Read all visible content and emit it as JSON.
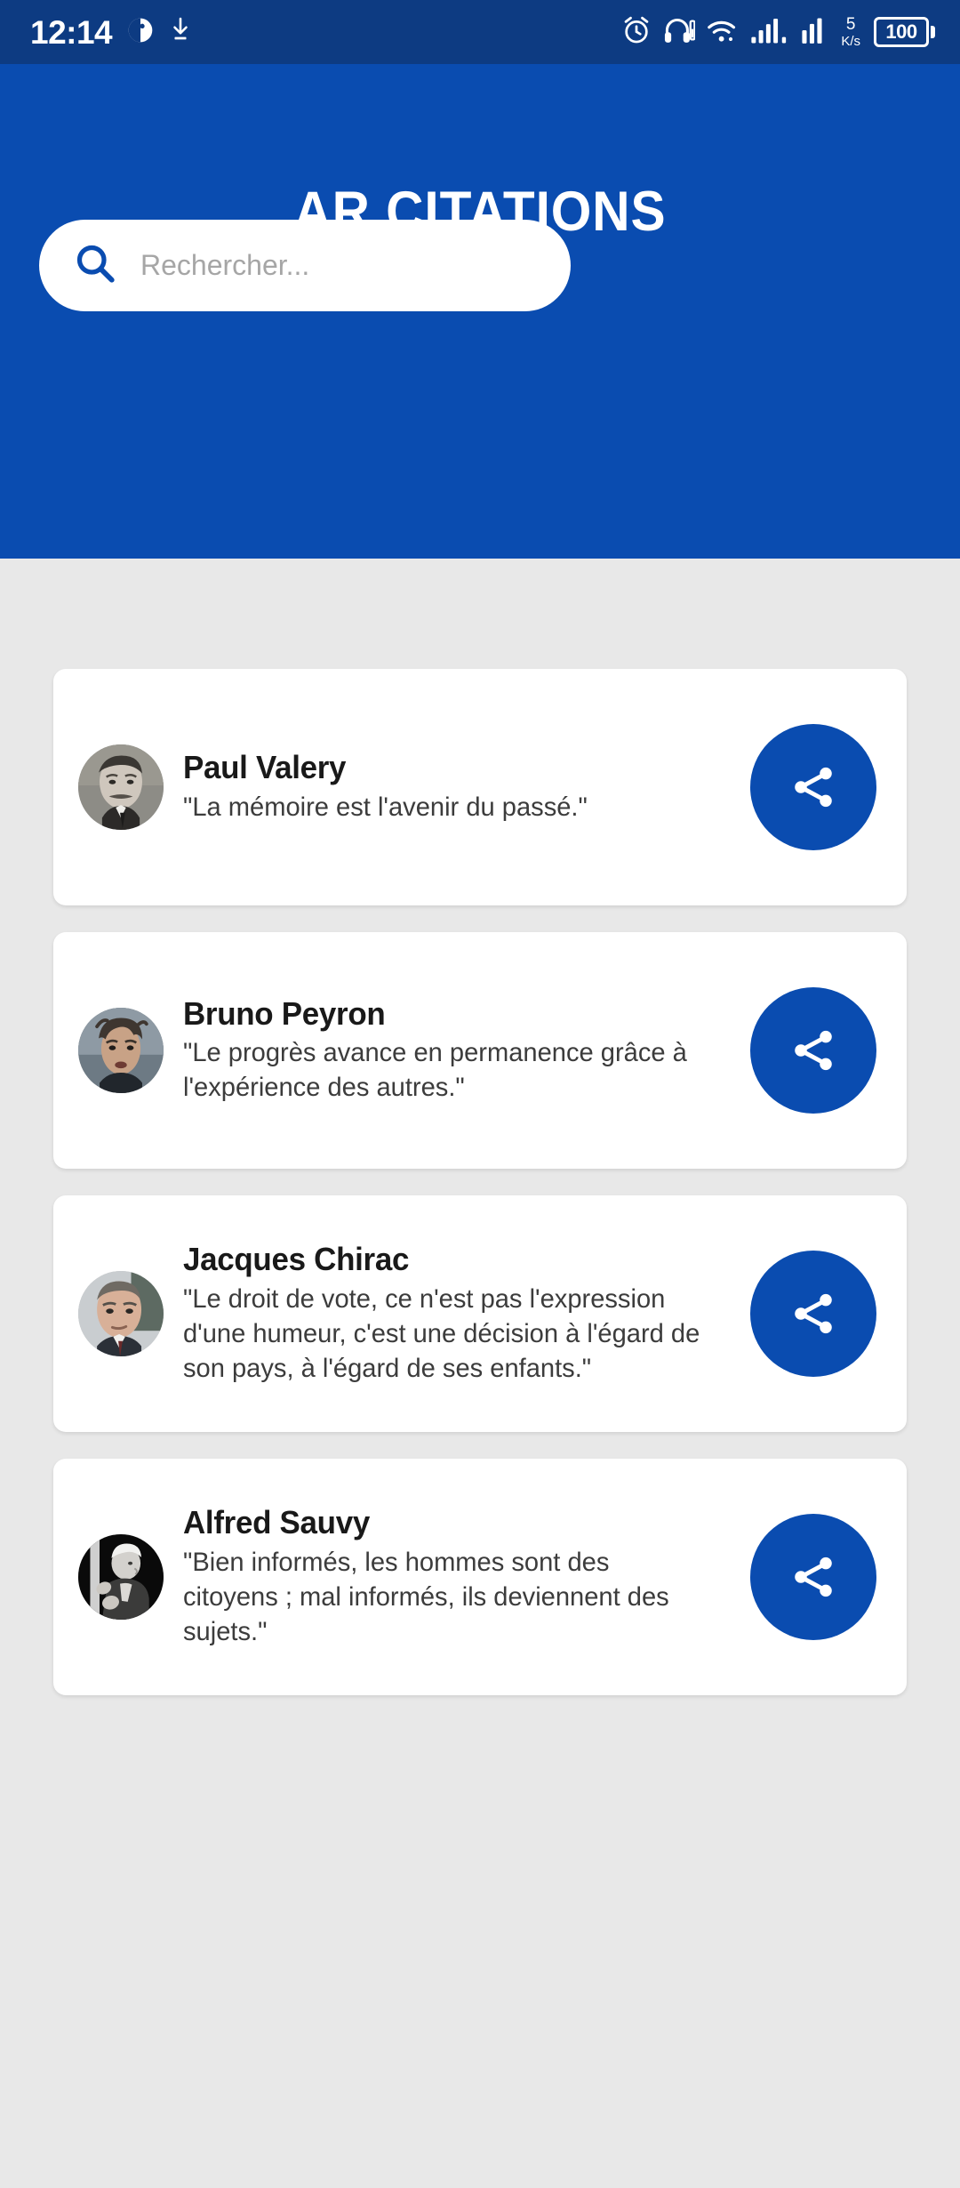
{
  "status_bar": {
    "time": "12:14",
    "icons_left": [
      "do-not-disturb-icon",
      "download-icon"
    ],
    "icons_right": [
      "alarm-icon",
      "headphones-icon",
      "wifi-icon",
      "signal-sim1-icon",
      "signal-sim2-icon"
    ],
    "net_speed_value": "5",
    "net_speed_unit": "K/s",
    "battery_level": "100"
  },
  "header": {
    "title": "AR CITATIONS",
    "background_color": "#0a4cb0"
  },
  "search": {
    "placeholder": "Rechercher...",
    "value": "",
    "icon": "search-icon"
  },
  "theme": {
    "accent": "#0a4cb0",
    "status_bar": "#0d3b82",
    "page_background": "#e8e8e8",
    "card_background": "#ffffff"
  },
  "quotes": [
    {
      "author": "Paul Valery",
      "text": "\"La mémoire est l'avenir du passé.\"",
      "share_label": "share-icon"
    },
    {
      "author": "Bruno Peyron",
      "text": "\"Le progrès avance en permanence grâce à l'expérience des autres.\"",
      "share_label": "share-icon"
    },
    {
      "author": "Jacques Chirac",
      "text": "\"Le droit de vote, ce n'est pas l'expression d'une humeur, c'est une décision à l'égard de son pays, à l'égard de ses enfants.\"",
      "share_label": "share-icon"
    },
    {
      "author": "Alfred Sauvy",
      "text": "\"Bien informés, les hommes sont des citoyens ; mal informés, ils deviennent des sujets.\"",
      "share_label": "share-icon"
    }
  ]
}
